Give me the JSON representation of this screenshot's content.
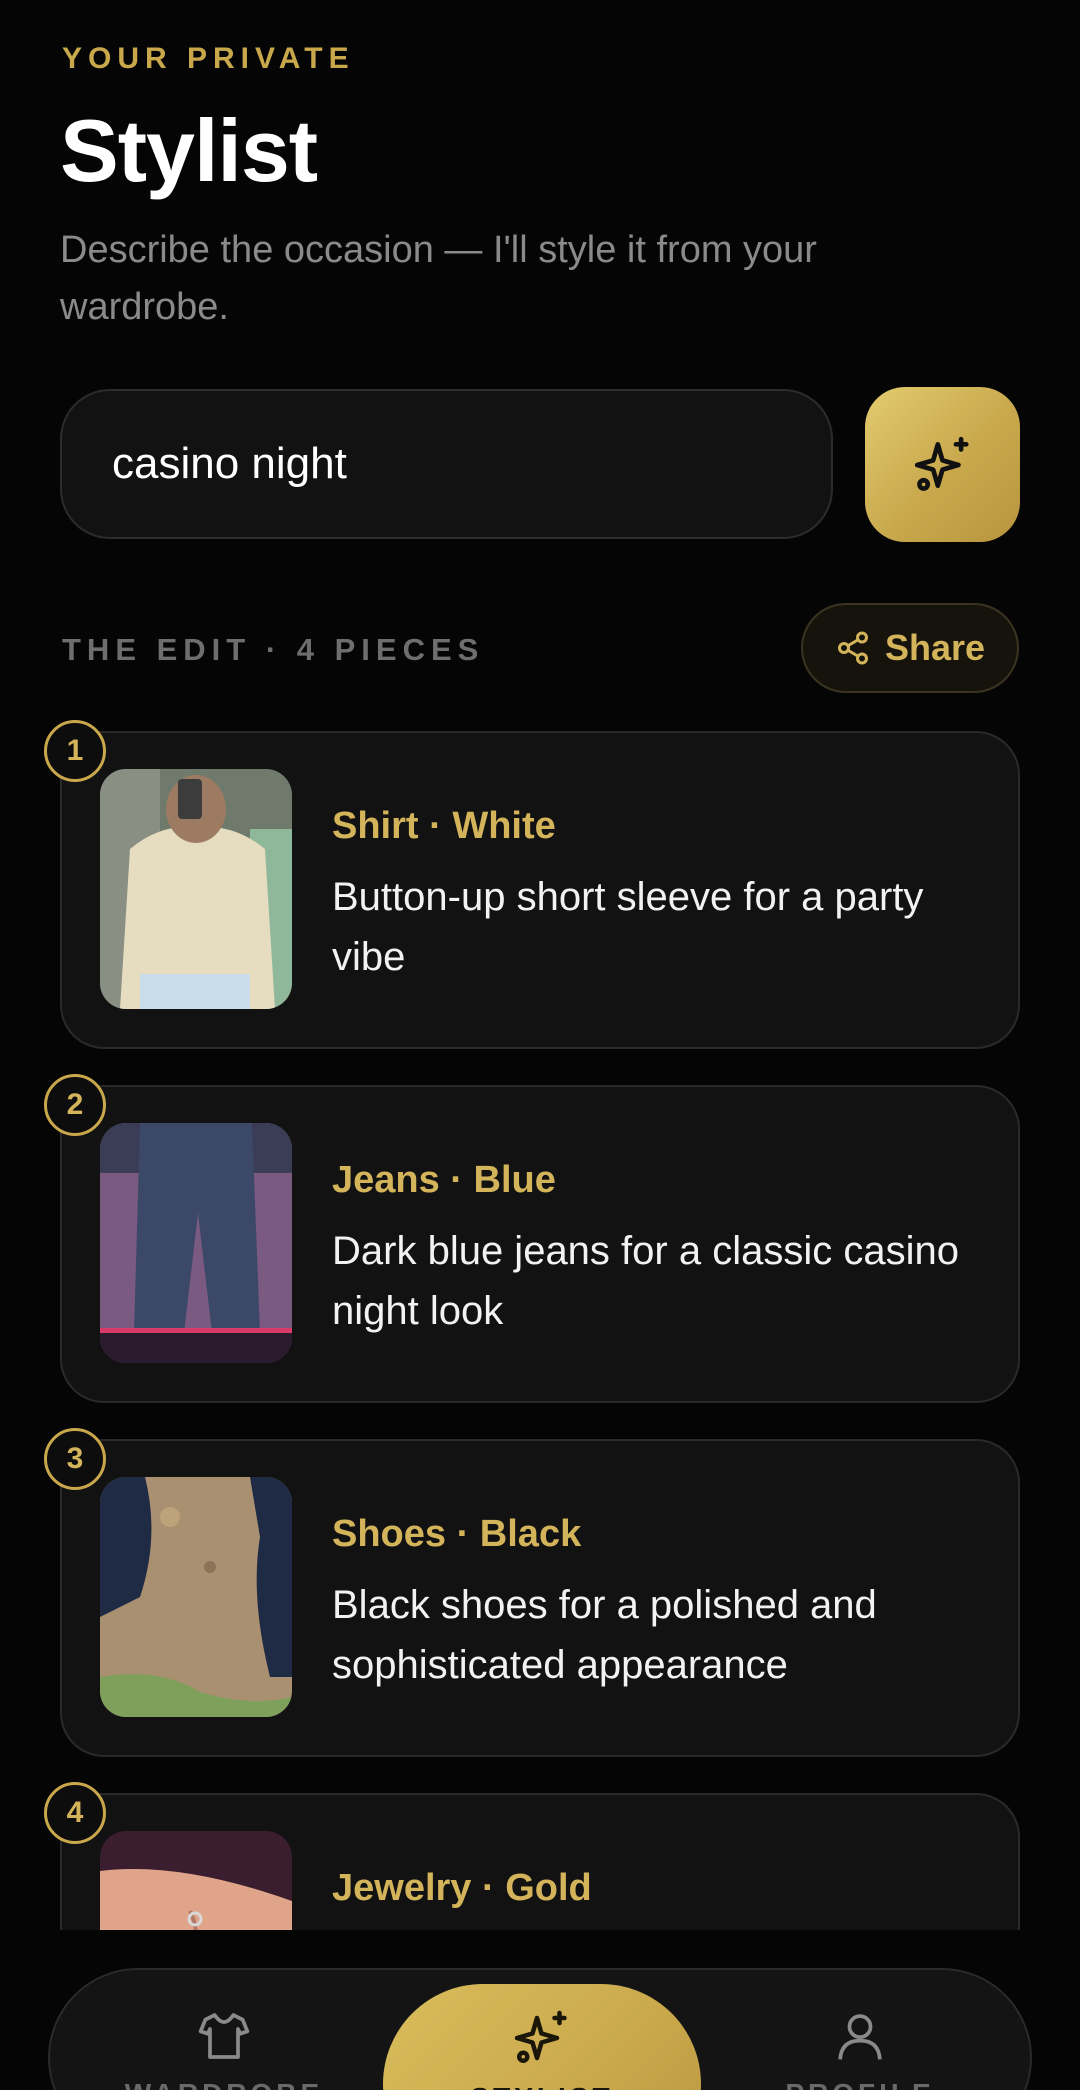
{
  "header": {
    "eyebrow": "YOUR PRIVATE",
    "title": "Stylist",
    "subtitle": "Describe the occasion — I'll style it from your wardrobe."
  },
  "prompt": {
    "value": "casino night",
    "submit_icon": "sparkles-icon"
  },
  "edit": {
    "label": "THE EDIT · 4 PIECES",
    "share_label": "Share",
    "share_icon": "share-icon"
  },
  "items": [
    {
      "number": "1",
      "title": "Shirt · White",
      "description": "Button-up short sleeve for a party vibe"
    },
    {
      "number": "2",
      "title": "Jeans · Blue",
      "description": "Dark blue jeans for a classic casino night look"
    },
    {
      "number": "3",
      "title": "Shoes · Black",
      "description": "Black shoes for a polished and sophisticated appearance"
    },
    {
      "number": "4",
      "title": "Jewelry · Gold",
      "description": ""
    }
  ],
  "nav": {
    "wardrobe": "WARDROBE",
    "stylist": "STYLIST",
    "profile": "PROFILE"
  },
  "colors": {
    "accent": "#c9a84c",
    "background": "#050505",
    "card": "#121212"
  }
}
